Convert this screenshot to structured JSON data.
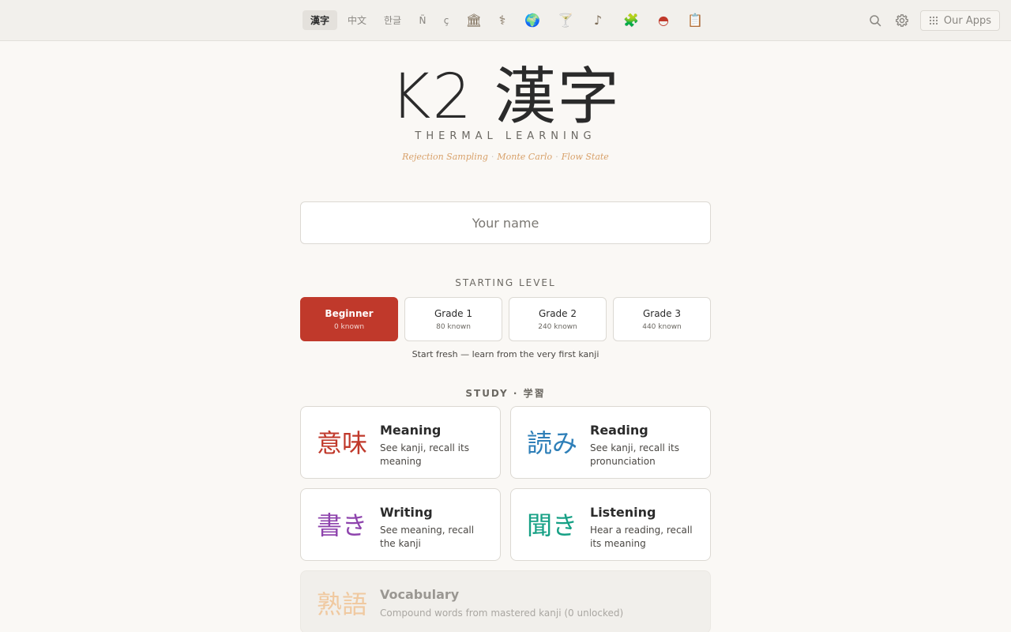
{
  "topbar": {
    "tabs": [
      {
        "label": "漢字",
        "icon": "",
        "active": true
      },
      {
        "label": "中文",
        "icon": "",
        "active": false
      },
      {
        "label": "한글",
        "icon": "",
        "active": false
      },
      {
        "label": "Ñ",
        "icon": "",
        "active": false
      },
      {
        "label": "ç",
        "icon": "",
        "active": false
      },
      {
        "label": "🏛",
        "icon": "bank-icon",
        "active": false
      },
      {
        "label": "⚕",
        "icon": "caduceus-icon",
        "active": false
      },
      {
        "label": "🌍",
        "icon": "globe-icon",
        "active": false
      },
      {
        "label": "🍸",
        "icon": "cocktail-icon",
        "active": false
      },
      {
        "label": "♪",
        "icon": "music-note-icon",
        "active": false
      },
      {
        "label": "🧩",
        "icon": "puzzle-icon",
        "active": false
      },
      {
        "label": "◓",
        "icon": "pokeball-icon",
        "active": false
      },
      {
        "label": "📋",
        "icon": "clipboard-icon",
        "active": false
      }
    ],
    "apps_label": "Our Apps"
  },
  "hero": {
    "title": "K2 漢字",
    "subtitle": "THERMAL LEARNING",
    "tags": [
      "Rejection Sampling",
      "Monte Carlo",
      "Flow State"
    ]
  },
  "name_input": {
    "placeholder": "Your name",
    "value": ""
  },
  "starting_level": {
    "label": "STARTING LEVEL",
    "levels": [
      {
        "name": "Beginner",
        "count": "0 known",
        "selected": true
      },
      {
        "name": "Grade 1",
        "count": "80 known",
        "selected": false
      },
      {
        "name": "Grade 2",
        "count": "240 known",
        "selected": false
      },
      {
        "name": "Grade 3",
        "count": "440 known",
        "selected": false
      }
    ],
    "description": "Start fresh — learn from the very first kanji"
  },
  "study": {
    "label": "STUDY · 学習",
    "cards": [
      {
        "glyph": "意味",
        "title": "Meaning",
        "desc": "See kanji, recall its meaning",
        "color": "#c0392b"
      },
      {
        "glyph": "読み",
        "title": "Reading",
        "desc": "See kanji, recall its pronunciation",
        "color": "#2e7fb8"
      },
      {
        "glyph": "書き",
        "title": "Writing",
        "desc": "See meaning, recall the kanji",
        "color": "#8e44ad"
      },
      {
        "glyph": "聞き",
        "title": "Listening",
        "desc": "Hear a reading, recall its meaning",
        "color": "#16a085"
      }
    ],
    "vocab": {
      "glyph": "熟語",
      "title": "Vocabulary",
      "desc": "Compound words from mastered kanji (0 unlocked)",
      "color": "#f0c9a0"
    }
  }
}
